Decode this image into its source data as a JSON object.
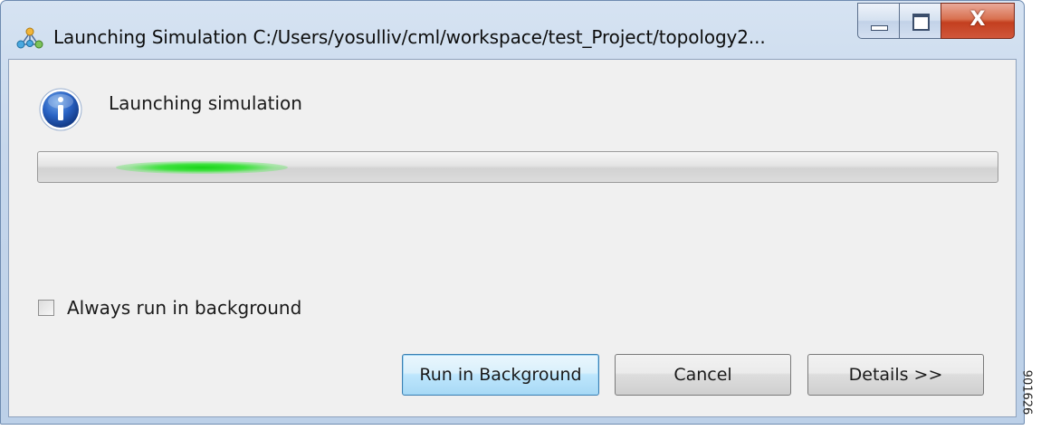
{
  "window": {
    "title": "Launching Simulation C:/Users/yosulliv/cml/workspace/test_Project/topology2...",
    "app_icon": "network-topology-icon",
    "close_symbol": "X"
  },
  "dialog": {
    "icon": "info-icon",
    "message": "Launching simulation",
    "progress": {
      "indeterminate": true,
      "color": "#22d022"
    },
    "checkbox": {
      "label": "Always run in background",
      "checked": false
    },
    "buttons": {
      "run_in_background": "Run in Background",
      "cancel": "Cancel",
      "details": "Details >>"
    }
  },
  "side_code": "901626"
}
